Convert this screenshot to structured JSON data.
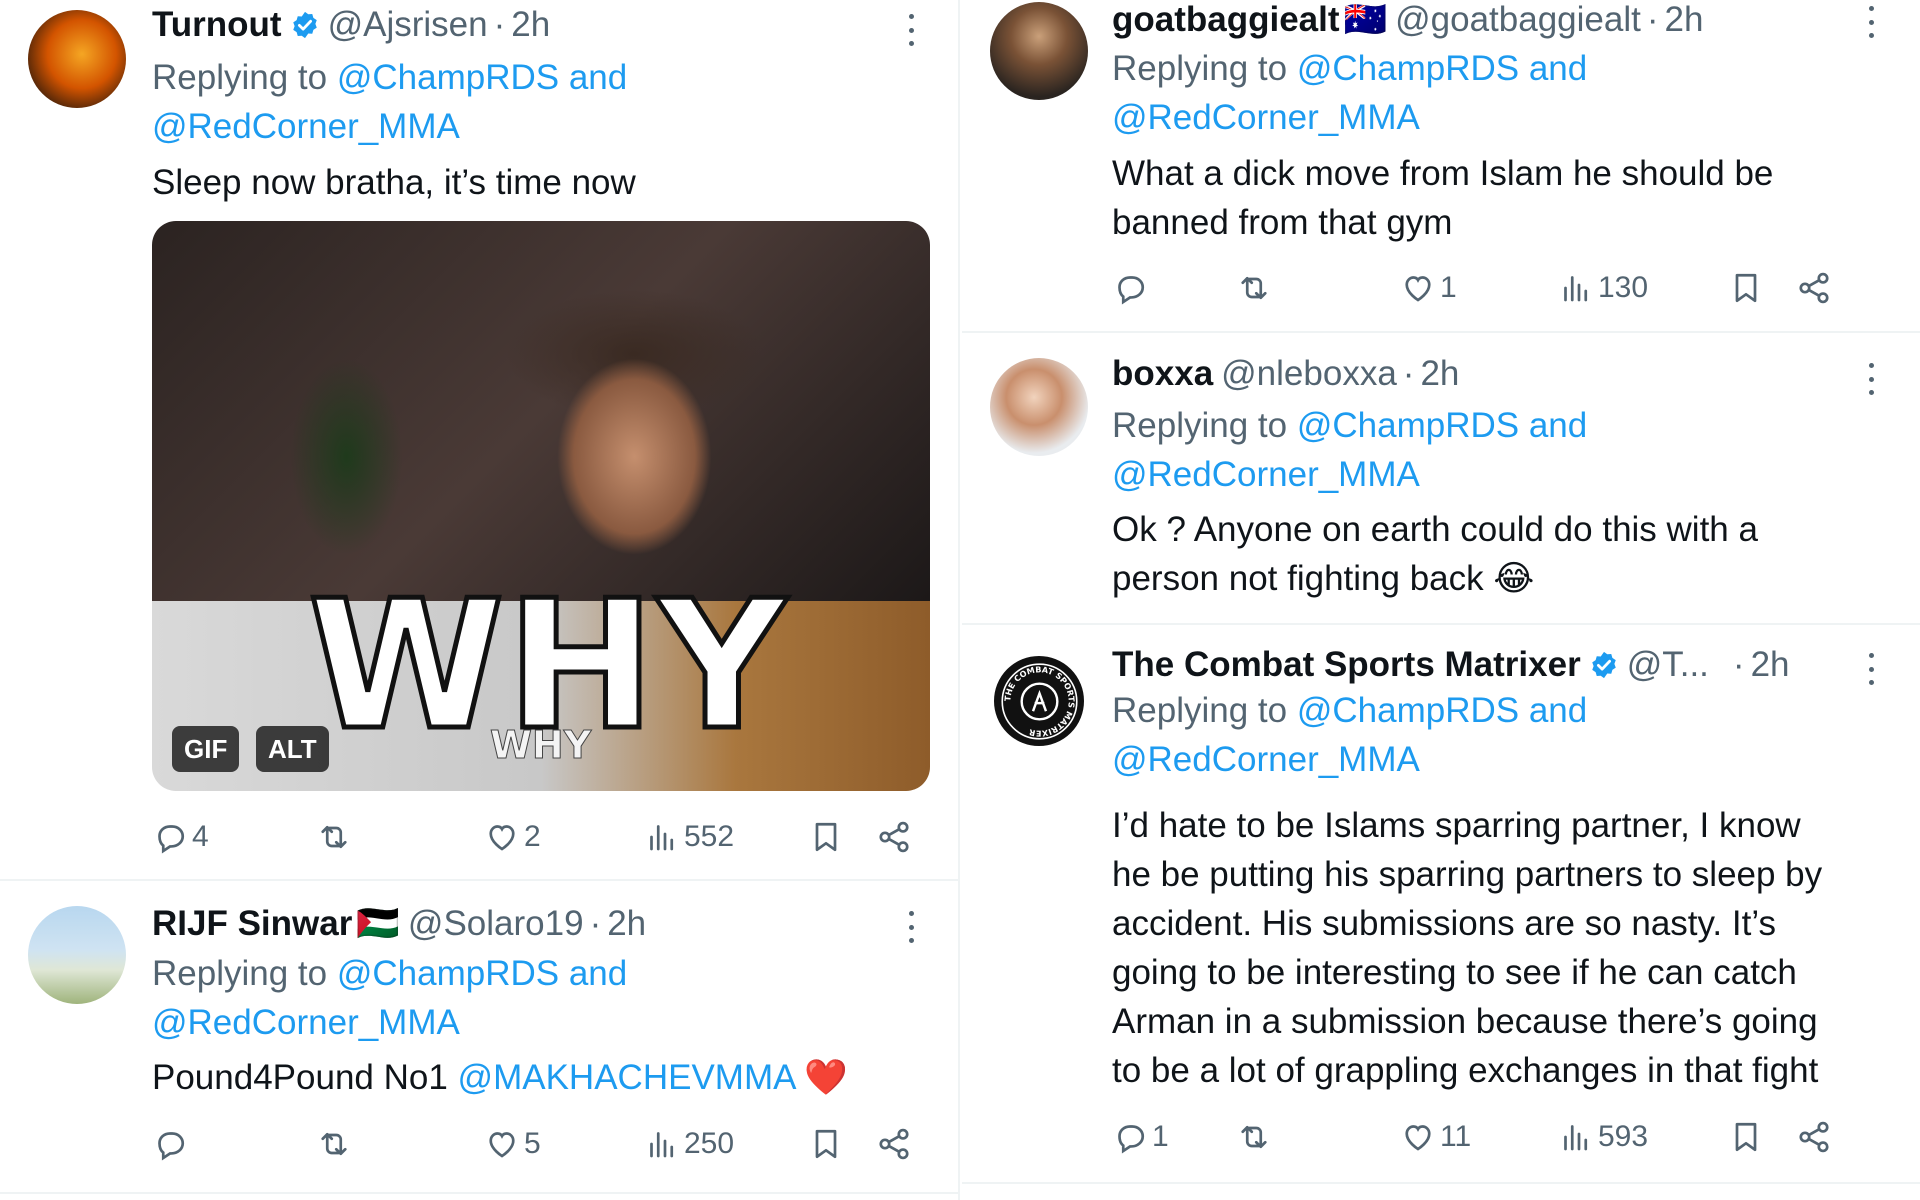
{
  "tweets": {
    "t1": {
      "name": "Turnout",
      "handle": "@Ajsrisen",
      "dot": "·",
      "time": "2h",
      "reply_prefix": "Replying to",
      "mention1": "@ChampRDS and",
      "mention2": "@RedCorner_MMA",
      "text": "Sleep now bratha, it’s time now",
      "media_caption": "WHY",
      "media_subcaption": "WHY",
      "media_badges": [
        "GIF",
        "ALT"
      ],
      "replies": "4",
      "likes": "2",
      "views": "552"
    },
    "t2": {
      "name": "RIJF Sinwar",
      "flag": "🇵🇸",
      "handle": "@Solaro19",
      "dot": "·",
      "time": "2h",
      "reply_prefix": "Replying to",
      "mention1": "@ChampRDS and",
      "mention2": "@RedCorner_MMA",
      "text_prefix": "Pound4Pound No1",
      "text_mention": "@MAKHACHEVMMA",
      "text_emoji": "❤️",
      "likes": "5",
      "views": "250"
    },
    "t3": {
      "name": "goatbaggiealt",
      "flag": "🇦🇺",
      "handle": "@goatbaggiealt",
      "dot": "·",
      "time": "2h",
      "reply_prefix": "Replying to",
      "mention1": "@ChampRDS and",
      "mention2": "@RedCorner_MMA",
      "text_line1": "What a dick move from Islam he should be",
      "text_line2": "banned from that gym",
      "likes": "1",
      "views": "130"
    },
    "t4": {
      "name": "boxxa",
      "handle": "@nleboxxa",
      "dot": "·",
      "time": "2h",
      "reply_prefix": "Replying to",
      "mention1": "@ChampRDS and",
      "mention2": "@RedCorner_MMA",
      "text_line1": "Ok ? Anyone on earth could do this with a",
      "text_line2": "person not fighting back 😂"
    },
    "t5": {
      "name": "The Combat Sports Matrixer",
      "handle": "@T...",
      "dot": "·",
      "time": "2h",
      "avatar_text": "THE COMBAT SPORTS MATRIXER",
      "reply_prefix": "Replying to",
      "mention1": "@ChampRDS and",
      "mention2": "@RedCorner_MMA",
      "text_lines": [
        "I’d hate to be Islams sparring partner, I know",
        "he be putting his sparring partners to sleep by",
        "accident. His submissions are so nasty. It’s",
        "going to be interesting to see if he can catch",
        "Arman in a submission because there’s going",
        "to be a lot of grappling exchanges in that fight"
      ],
      "replies": "1",
      "likes": "11",
      "views": "593"
    }
  },
  "colors": {
    "link": "#1d9bf0",
    "secondary_text": "#536471",
    "primary_text": "#0f1419",
    "verified": "#1d9bf0",
    "divider": "#eff3f4"
  },
  "icons": [
    "reply-icon",
    "retweet-icon",
    "like-icon",
    "views-icon",
    "bookmark-icon",
    "share-icon",
    "more-icon",
    "verified-badge-icon"
  ]
}
